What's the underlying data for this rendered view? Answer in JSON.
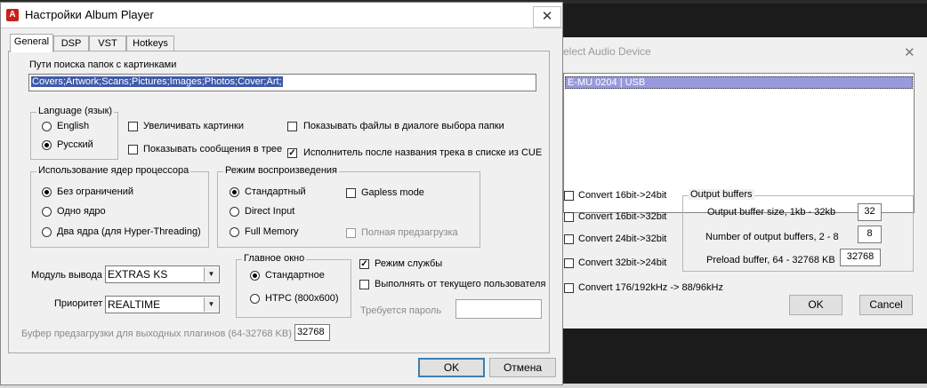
{
  "main": {
    "title": "Настройки Album Player",
    "close_glyph": "✕",
    "app_icon_glyph": "A",
    "tabs": [
      {
        "label": "General"
      },
      {
        "label": "DSP"
      },
      {
        "label": "VST"
      },
      {
        "label": "Hotkeys"
      }
    ],
    "folder_search": {
      "label": "Пути поиска папок с картинками",
      "value": "Covers;Artwork;Scans;Pictures;Images;Photos;Cover;Art;"
    },
    "language": {
      "legend": "Language (язык)",
      "options": [
        {
          "label": "English",
          "selected": false
        },
        {
          "label": "Русский",
          "selected": true
        }
      ]
    },
    "checks": {
      "enlarge_images": {
        "label": "Увеличивать картинки",
        "checked": false
      },
      "show_files": {
        "label": "Показывать файлы в диалоге выбора папки",
        "checked": false
      },
      "show_messages_tray": {
        "label": "Показывать сообщения в трее",
        "checked": false
      },
      "artist_after_track": {
        "label": "Исполнитель после названия трека в списке из CUE",
        "checked": true
      }
    },
    "cpu_cores": {
      "legend": "Использование ядер процессора",
      "options": [
        {
          "label": "Без ограничений",
          "selected": true
        },
        {
          "label": "Одно ядро",
          "selected": false
        },
        {
          "label": "Два ядра (для Hyper-Threading)",
          "selected": false
        }
      ]
    },
    "playback_mode": {
      "legend": "Режим воспроизведения",
      "options": [
        {
          "label": "Стандартный",
          "selected": true
        },
        {
          "label": "Direct Input",
          "selected": false
        },
        {
          "label": "Full Memory",
          "selected": false
        }
      ],
      "gapless": {
        "label": "Gapless mode",
        "checked": false
      },
      "full_preload": {
        "label": "Полная предзагрузка",
        "checked": false,
        "disabled": true
      }
    },
    "output_module": {
      "label": "Модуль вывода",
      "value": "EXTRAS KS"
    },
    "priority": {
      "label": "Приоритет",
      "value": "REALTIME"
    },
    "main_window": {
      "legend": "Главное окно",
      "options": [
        {
          "label": "Стандартное",
          "selected": true
        },
        {
          "label": "HTPC (800x600)",
          "selected": false
        }
      ]
    },
    "service_mode": {
      "label": "Режим службы",
      "checked": true
    },
    "run_as_current_user": {
      "label": "Выполнять от текущего пользователя",
      "checked": false
    },
    "password": {
      "label": "Требуется пароль",
      "value": ""
    },
    "preload_buffer": {
      "label": "Буфер предзагрузки для выходных плагинов (64-32768 KB)",
      "value": "32768"
    },
    "ok_label": "OK",
    "cancel_label": "Отмена"
  },
  "device_dialog": {
    "title": "elect Audio Device",
    "close_glyph": "✕",
    "devices": [
      "E-MU 0204 | USB"
    ],
    "converts": [
      {
        "label": "Convert 16bit->24bit",
        "checked": false
      },
      {
        "label": "Convert 16bit->32bit",
        "checked": false
      },
      {
        "label": "Convert 24bit->32bit",
        "checked": false
      },
      {
        "label": "Convert 32bit->24bit",
        "checked": false
      },
      {
        "label": "Convert 176/192kHz -> 88/96kHz",
        "checked": false
      }
    ],
    "output_buffers": {
      "legend": "Output buffers",
      "rows": [
        {
          "label": "Output buffer size, 1kb - 32kb",
          "value": "32"
        },
        {
          "label": "Number of output buffers, 2 - 8",
          "value": "8"
        },
        {
          "label": "Preload buffer, 64 - 32768 KB",
          "value": "32768"
        }
      ]
    },
    "ok_label": "OK",
    "cancel_label": "Cancel"
  },
  "icons": {
    "combo_arrow": "▼",
    "check_mark": "✓"
  }
}
